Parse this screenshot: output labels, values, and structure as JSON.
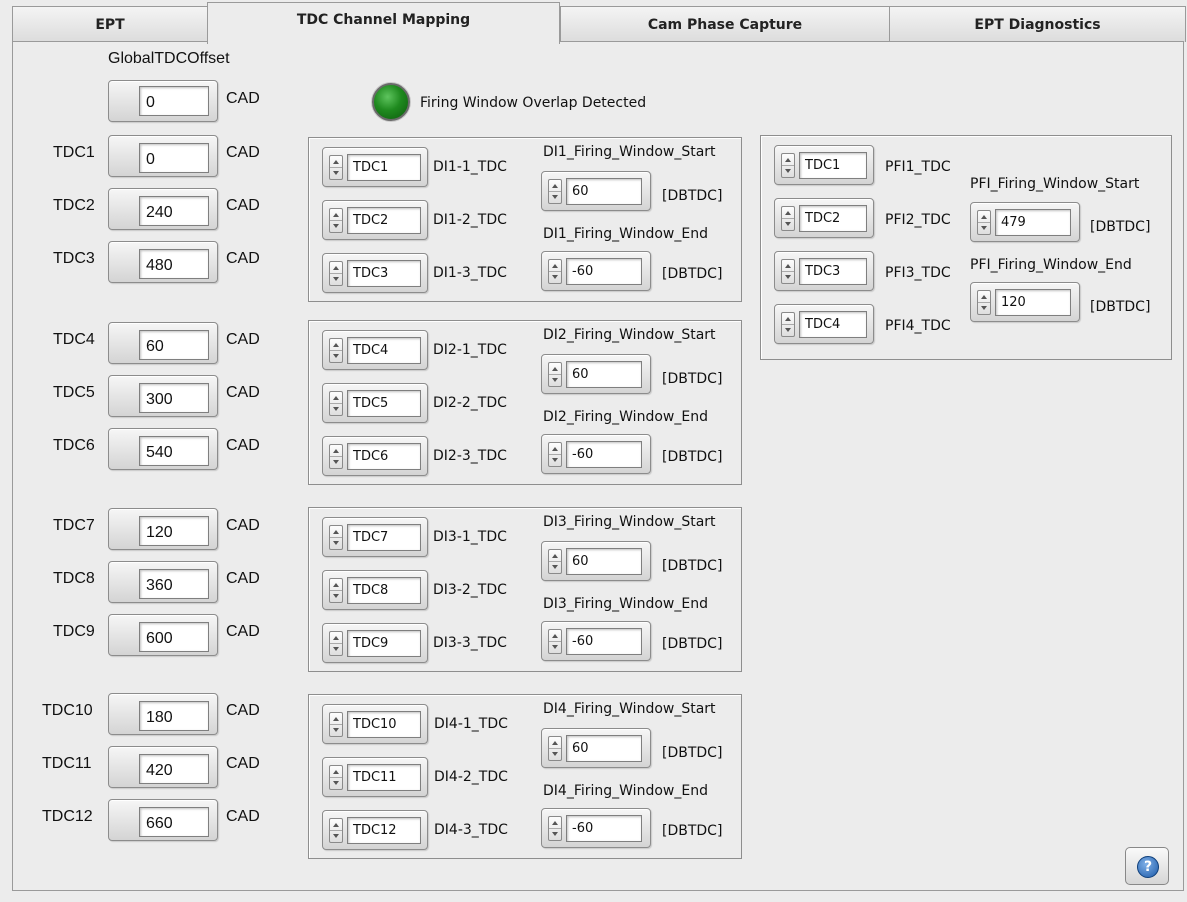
{
  "tabs": [
    {
      "label": "EPT",
      "active": false
    },
    {
      "label": "TDC Channel Mapping",
      "active": true
    },
    {
      "label": "Cam Phase Capture",
      "active": false
    },
    {
      "label": "EPT Diagnostics",
      "active": false
    }
  ],
  "global_offset": {
    "label": "GlobalTDCOffset",
    "value": "0",
    "unit": "CAD"
  },
  "indicator": {
    "label": "Firing Window Overlap Detected",
    "color": "#1f8a1f",
    "state": "on"
  },
  "tdc_values": [
    {
      "label": "TDC1",
      "value": "0",
      "unit": "CAD"
    },
    {
      "label": "TDC2",
      "value": "240",
      "unit": "CAD"
    },
    {
      "label": "TDC3",
      "value": "480",
      "unit": "CAD"
    },
    {
      "label": "TDC4",
      "value": "60",
      "unit": "CAD"
    },
    {
      "label": "TDC5",
      "value": "300",
      "unit": "CAD"
    },
    {
      "label": "TDC6",
      "value": "540",
      "unit": "CAD"
    },
    {
      "label": "TDC7",
      "value": "120",
      "unit": "CAD"
    },
    {
      "label": "TDC8",
      "value": "360",
      "unit": "CAD"
    },
    {
      "label": "TDC9",
      "value": "600",
      "unit": "CAD"
    },
    {
      "label": "TDC10",
      "value": "180",
      "unit": "CAD"
    },
    {
      "label": "TDC11",
      "value": "420",
      "unit": "CAD"
    },
    {
      "label": "TDC12",
      "value": "660",
      "unit": "CAD"
    }
  ],
  "di_groups": [
    {
      "channels": [
        {
          "value": "TDC1",
          "label": "DI1-1_TDC"
        },
        {
          "value": "TDC2",
          "label": "DI1-2_TDC"
        },
        {
          "value": "TDC3",
          "label": "DI1-3_TDC"
        }
      ],
      "start_label": "DI1_Firing_Window_Start",
      "start_value": "60",
      "end_label": "DI1_Firing_Window_End",
      "end_value": "-60",
      "unit": "[DBTDC]"
    },
    {
      "channels": [
        {
          "value": "TDC4",
          "label": "DI2-1_TDC"
        },
        {
          "value": "TDC5",
          "label": "DI2-2_TDC"
        },
        {
          "value": "TDC6",
          "label": "DI2-3_TDC"
        }
      ],
      "start_label": "DI2_Firing_Window_Start",
      "start_value": "60",
      "end_label": "DI2_Firing_Window_End",
      "end_value": "-60",
      "unit": "[DBTDC]"
    },
    {
      "channels": [
        {
          "value": "TDC7",
          "label": "DI3-1_TDC"
        },
        {
          "value": "TDC8",
          "label": "DI3-2_TDC"
        },
        {
          "value": "TDC9",
          "label": "DI3-3_TDC"
        }
      ],
      "start_label": "DI3_Firing_Window_Start",
      "start_value": "60",
      "end_label": "DI3_Firing_Window_End",
      "end_value": "-60",
      "unit": "[DBTDC]"
    },
    {
      "channels": [
        {
          "value": "TDC10",
          "label": "DI4-1_TDC"
        },
        {
          "value": "TDC11",
          "label": "DI4-2_TDC"
        },
        {
          "value": "TDC12",
          "label": "DI4-3_TDC"
        }
      ],
      "start_label": "DI4_Firing_Window_Start",
      "start_value": "60",
      "end_label": "DI4_Firing_Window_End",
      "end_value": "-60",
      "unit": "[DBTDC]"
    }
  ],
  "pfi_group": {
    "channels": [
      {
        "value": "TDC1",
        "label": "PFI1_TDC"
      },
      {
        "value": "TDC2",
        "label": "PFI2_TDC"
      },
      {
        "value": "TDC3",
        "label": "PFI3_TDC"
      },
      {
        "value": "TDC4",
        "label": "PFI4_TDC"
      }
    ],
    "start_label": "PFI_Firing_Window_Start",
    "start_value": "479",
    "end_label": "PFI_Firing_Window_End",
    "end_value": "120",
    "unit": "[DBTDC]"
  },
  "help": {
    "glyph": "?",
    "icon": "help-icon"
  }
}
